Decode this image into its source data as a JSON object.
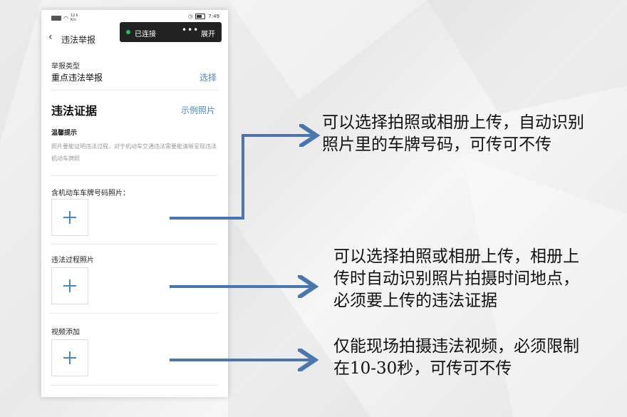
{
  "status_bar": {
    "speed_num": "12 k",
    "speed_unit": "K/s",
    "time": "7:49"
  },
  "nav": {
    "title": "违法举报"
  },
  "toast": {
    "status": "已连接",
    "more": "•••",
    "expand": "展开"
  },
  "report_type": {
    "label": "举报类型",
    "value": "重点违法举报",
    "select": "选择"
  },
  "evidence": {
    "title": "违法证据",
    "example_link": "示例照片",
    "tip_title": "温馨提示",
    "tip_text": "照片要能证明违法过程，对于机动车交通违法需要能清晰呈现违法机动车牌照"
  },
  "fields": [
    {
      "label": "含机动车车牌号码照片："
    },
    {
      "label": "违法过程照片"
    },
    {
      "label": "视频添加"
    }
  ],
  "notes": [
    "可以选择拍照或相册上传，自动识别照片里的车牌号码，可传可不传",
    "可以选择拍照或相册上传，相册上传时自动识别照片拍摄时间地点，必须要上传的违法证据",
    "仅能现场拍摄违法视频，必须限制在10-30秒，可传可不传"
  ],
  "colors": {
    "accent": "#4a86c6",
    "arrow": "#4a76b0",
    "toast_bg": "#222222",
    "connected": "#22c25a"
  },
  "icons": [
    "back-arrow-icon",
    "plus-icon",
    "battery-icon",
    "alarm-icon",
    "signal-icon",
    "wifi-icon"
  ]
}
